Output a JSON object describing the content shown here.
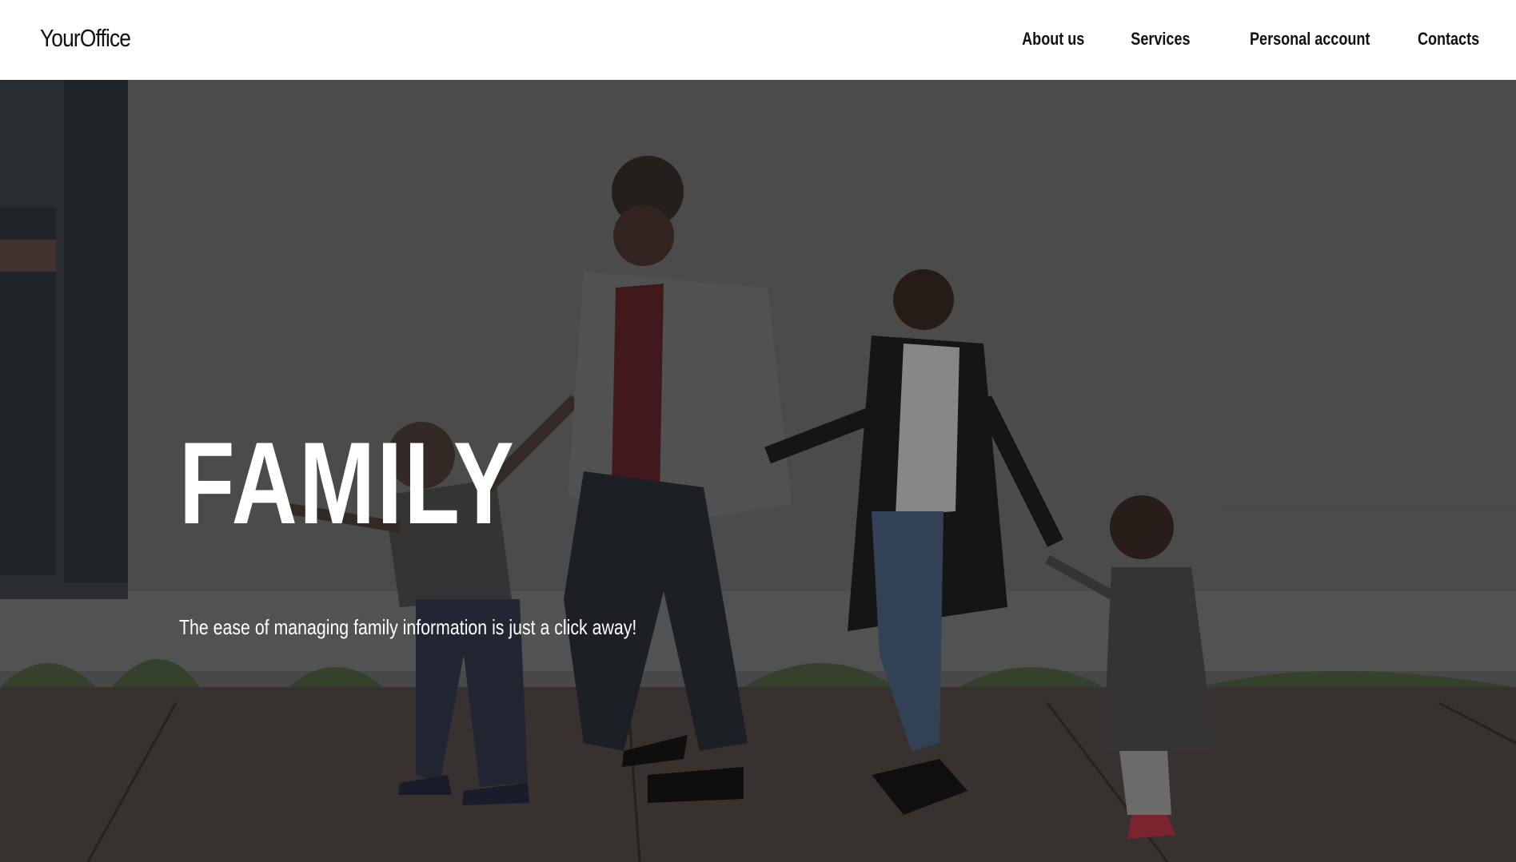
{
  "header": {
    "logo": "YourOffice",
    "nav": [
      {
        "label": "About us"
      },
      {
        "label": "Services"
      },
      {
        "label": "Personal account"
      },
      {
        "label": "Contacts"
      }
    ]
  },
  "hero": {
    "title": "FAMILY",
    "subtitle": "The ease of managing family information is just a click away!",
    "image": "family-walking-photo"
  },
  "colors": {
    "header_bg": "#ffffff",
    "text_dark": "#111111",
    "hero_text": "#ffffff",
    "hero_overlay": "#4a4a4a"
  }
}
